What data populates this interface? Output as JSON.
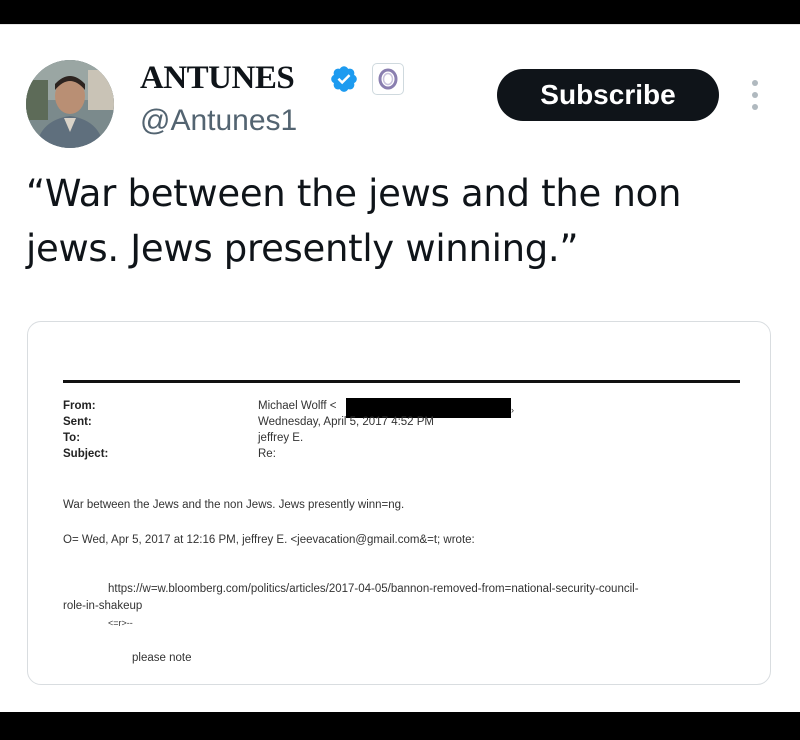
{
  "author": {
    "name": "ANTUNES",
    "handle": "@Antunes1",
    "avatar_icon": "profile-photo",
    "verified_icon": "verified-badge-icon",
    "verified_color": "#1d9bf0",
    "affiliation_icon": "affiliate-badge-icon"
  },
  "actions": {
    "subscribe_label": "Subscribe",
    "more_icon": "more-vertical-icon"
  },
  "tweet": {
    "text": "“War between the jews and the non jews. Jews presently winning.”"
  },
  "email": {
    "labels": {
      "from": "From:",
      "sent": "Sent:",
      "to": "To:",
      "subject": "Subject:"
    },
    "from_value": "Michael Wolff <",
    "sent_value": "Wednesday, April 5, 2017 4:52 PM",
    "to_value": "jeffrey E.",
    "subject_value": "Re:",
    "line1": "War between the Jews and the non Jews. Jews presently winn=ng.",
    "line2": "O= Wed, Apr 5, 2017 at 12:16 PM, jeffrey E. <jeevacation@gmail.com&=t; wrote:",
    "link_line1": "https://w=w.bloomberg.com/politics/articles/2017-04-05/bannon-removed-from=national-security-council-",
    "link_line2": "role-in-shakeup",
    "marker": "<=r>--",
    "note": "please note"
  }
}
